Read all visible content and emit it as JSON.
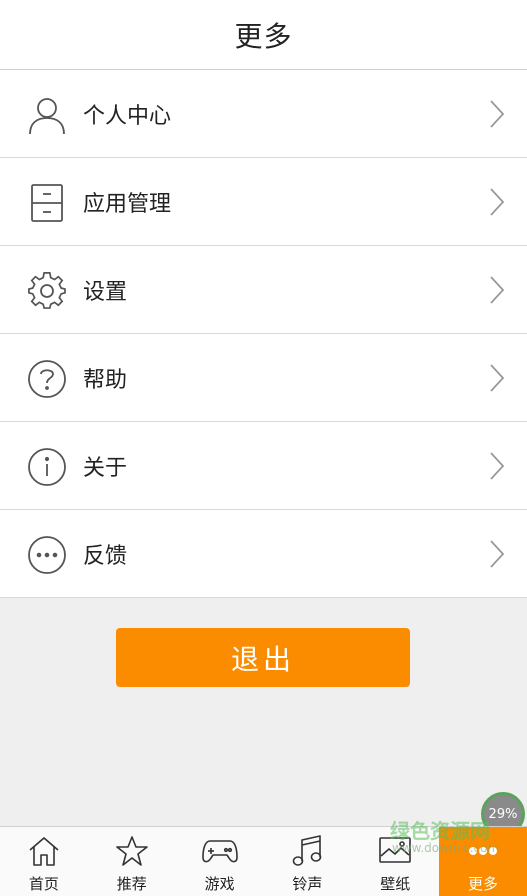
{
  "header": {
    "title": "更多"
  },
  "menu": {
    "items": [
      {
        "label": "个人中心",
        "icon": "user-icon"
      },
      {
        "label": "应用管理",
        "icon": "cabinet-icon"
      },
      {
        "label": "设置",
        "icon": "gear-icon"
      },
      {
        "label": "帮助",
        "icon": "help-icon"
      },
      {
        "label": "关于",
        "icon": "info-icon"
      },
      {
        "label": "反馈",
        "icon": "more-dots-icon"
      }
    ]
  },
  "logout": {
    "label": "退出"
  },
  "badge": {
    "progress": "29%"
  },
  "tabbar": {
    "active": 5,
    "tabs": [
      {
        "label": "首页",
        "icon": "home-icon"
      },
      {
        "label": "推荐",
        "icon": "star-icon"
      },
      {
        "label": "游戏",
        "icon": "gamepad-icon"
      },
      {
        "label": "铃声",
        "icon": "music-icon"
      },
      {
        "label": "壁纸",
        "icon": "wallpaper-icon"
      },
      {
        "label": "更多",
        "icon": "more-icon"
      }
    ]
  },
  "watermark": {
    "main": "绿色资源网",
    "sub": "www.downcc.com"
  },
  "colors": {
    "accent": "#fb8c00",
    "badge_ring": "#5ba35b"
  }
}
